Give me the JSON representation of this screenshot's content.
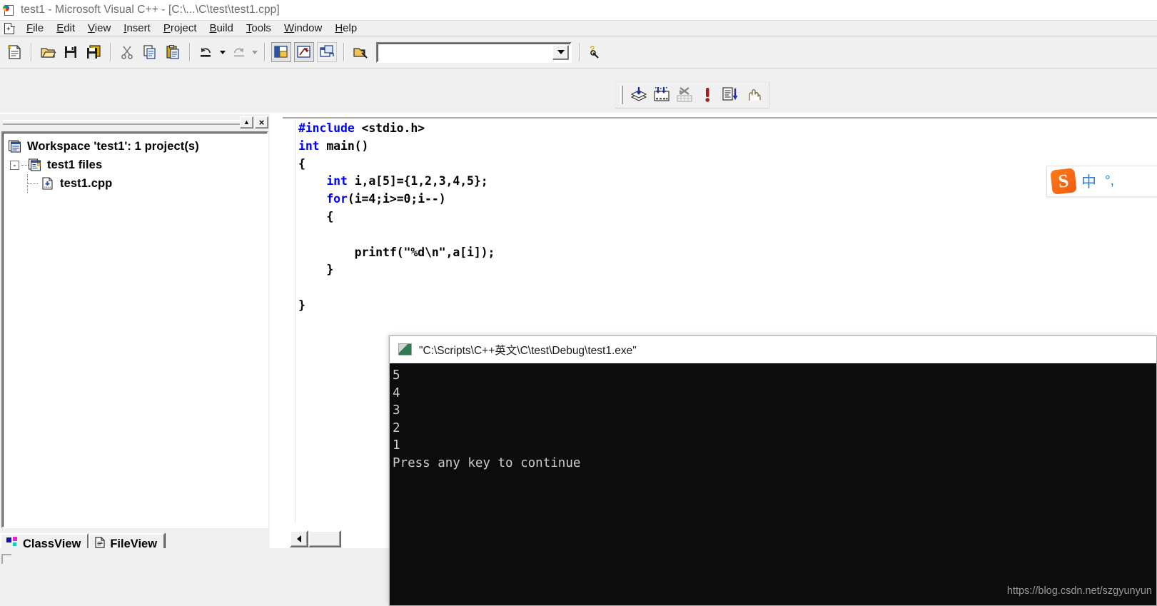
{
  "window": {
    "title": "test1 - Microsoft Visual C++ - [C:\\...\\C\\test\\test1.cpp]",
    "app_icon": "vcpp-document-icon"
  },
  "menubar": {
    "mdi_icon": "mdi-child-document-icon",
    "items": [
      {
        "label": "File",
        "accel": "F"
      },
      {
        "label": "Edit",
        "accel": "E"
      },
      {
        "label": "View",
        "accel": "V"
      },
      {
        "label": "Insert",
        "accel": "I"
      },
      {
        "label": "Project",
        "accel": "P"
      },
      {
        "label": "Build",
        "accel": "B"
      },
      {
        "label": "Tools",
        "accel": "T"
      },
      {
        "label": "Window",
        "accel": "W"
      },
      {
        "label": "Help",
        "accel": "H"
      }
    ]
  },
  "toolbar_standard": {
    "buttons": [
      {
        "name": "new-text-file-icon",
        "tip": "New Text File"
      },
      {
        "name": "open-icon",
        "tip": "Open"
      },
      {
        "name": "save-icon",
        "tip": "Save"
      },
      {
        "name": "save-all-icon",
        "tip": "Save All"
      },
      {
        "name": "cut-icon",
        "tip": "Cut"
      },
      {
        "name": "copy-icon",
        "tip": "Copy"
      },
      {
        "name": "paste-icon",
        "tip": "Paste"
      },
      {
        "name": "undo-icon",
        "tip": "Undo"
      },
      {
        "name": "redo-icon",
        "tip": "Redo"
      },
      {
        "name": "workspace-window-icon",
        "tip": "Workspace"
      },
      {
        "name": "output-window-icon",
        "tip": "Output"
      },
      {
        "name": "window-list-icon",
        "tip": "Window List"
      },
      {
        "name": "find-in-files-icon",
        "tip": "Find in Files"
      },
      {
        "name": "find-help-icon",
        "tip": "Search"
      }
    ],
    "find_combo": {
      "value": "",
      "placeholder": "",
      "dropdown_icon": "chevron-down-icon"
    }
  },
  "toolbar_build": {
    "buttons": [
      {
        "name": "compile-icon",
        "tip": "Compile"
      },
      {
        "name": "build-icon",
        "tip": "Build"
      },
      {
        "name": "stop-build-icon",
        "tip": "Stop Build"
      },
      {
        "name": "execute-program-icon",
        "tip": "Execute Program"
      },
      {
        "name": "go-debug-icon",
        "tip": "Go"
      },
      {
        "name": "insert-breakpoint-icon",
        "tip": "Insert/Remove Breakpoint"
      }
    ]
  },
  "workspace": {
    "caption_buttons": [
      {
        "name": "minimize-panel-button",
        "glyph": "▲"
      },
      {
        "name": "close-panel-button",
        "glyph": "×"
      }
    ],
    "tree": [
      {
        "level": 0,
        "label": "Workspace 'test1': 1 project(s)",
        "icon": "workspace-icon",
        "expander": ""
      },
      {
        "level": 1,
        "label": "test1 files",
        "icon": "project-icon",
        "expander": "-"
      },
      {
        "level": 2,
        "label": "test1.cpp",
        "icon": "cpp-file-icon",
        "expander": ""
      }
    ],
    "tabs": [
      {
        "label": "ClassView",
        "icon": "classview-icon",
        "selected": false
      },
      {
        "label": "FileView",
        "icon": "fileview-icon",
        "selected": true
      }
    ]
  },
  "editor": {
    "filename": "test1.cpp",
    "code_lines": [
      [
        {
          "t": "#include",
          "c": "pp"
        },
        {
          "t": " <stdio.h>",
          "c": ""
        }
      ],
      [
        {
          "t": "int",
          "c": "kw"
        },
        {
          "t": " main()",
          "c": ""
        }
      ],
      [
        {
          "t": "{",
          "c": ""
        }
      ],
      [
        {
          "t": "    ",
          "c": ""
        },
        {
          "t": "int",
          "c": "kw"
        },
        {
          "t": " i,a[5]={1,2,3,4,5};",
          "c": ""
        }
      ],
      [
        {
          "t": "    ",
          "c": ""
        },
        {
          "t": "for",
          "c": "kw"
        },
        {
          "t": "(i=4;i>=0;i--)",
          "c": ""
        }
      ],
      [
        {
          "t": "    {",
          "c": ""
        }
      ],
      [
        {
          "t": "",
          "c": ""
        }
      ],
      [
        {
          "t": "        printf(\"%d\\n\",a[i]);",
          "c": ""
        }
      ],
      [
        {
          "t": "    }",
          "c": ""
        }
      ],
      [
        {
          "t": "",
          "c": ""
        }
      ],
      [
        {
          "t": "}",
          "c": ""
        }
      ]
    ],
    "hscrollbar": {
      "left_arrow_icon": "arrow-left-icon"
    }
  },
  "console": {
    "icon": "console-window-icon",
    "title": "\"C:\\Scripts\\C++英文\\C\\test\\Debug\\test1.exe\"",
    "output": "5\n4\n3\n2\n1\nPress any key to continue",
    "output_lines": [
      "5",
      "4",
      "3",
      "2",
      "1",
      "Press any key to continue"
    ]
  },
  "ime": {
    "logo_letter": "S",
    "mode_label": "中",
    "punctuation_label": "°,"
  },
  "watermark": {
    "text": "https://blog.csdn.net/szgyunyun"
  },
  "colors": {
    "keyword_blue": "#0000ff",
    "console_bg": "#0c0c0c",
    "console_fg": "#cccccc",
    "chrome_bg": "#f0f0f0",
    "title_fg": "#6c6c6c",
    "ime_orange": "#f05a0f",
    "ime_blue": "#2f7fd6"
  }
}
